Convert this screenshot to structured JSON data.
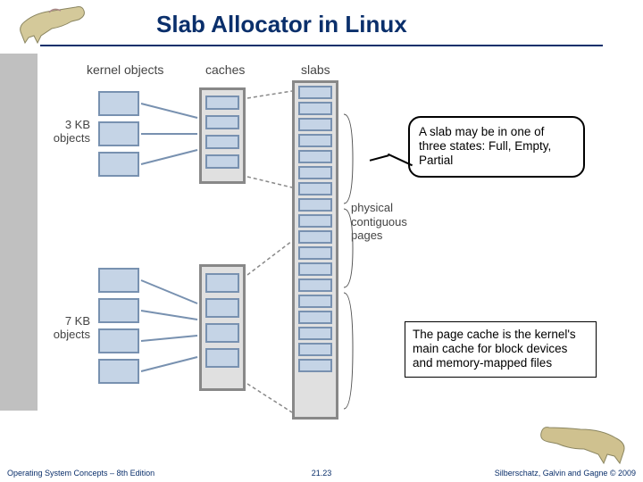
{
  "title": "Slab Allocator in Linux",
  "labels": {
    "kernel_objects": "kernel objects",
    "caches": "caches",
    "slabs": "slabs",
    "row1_size": "3 KB",
    "row1_name": "objects",
    "row2_size": "7 KB",
    "row2_name": "objects",
    "pages": "physical\ncontiguous\npages"
  },
  "callouts": {
    "c1": "A slab may be in one of three states: Full, Empty, Partial",
    "c2": "The page cache is the kernel's main cache for block devices and memory-mapped files"
  },
  "footer": {
    "left": "Operating System Concepts – 8th Edition",
    "center": "21.23",
    "right": "Silberschatz, Galvin and Gagne © 2009"
  },
  "icons": {
    "dino": "dinosaur-illustration"
  }
}
